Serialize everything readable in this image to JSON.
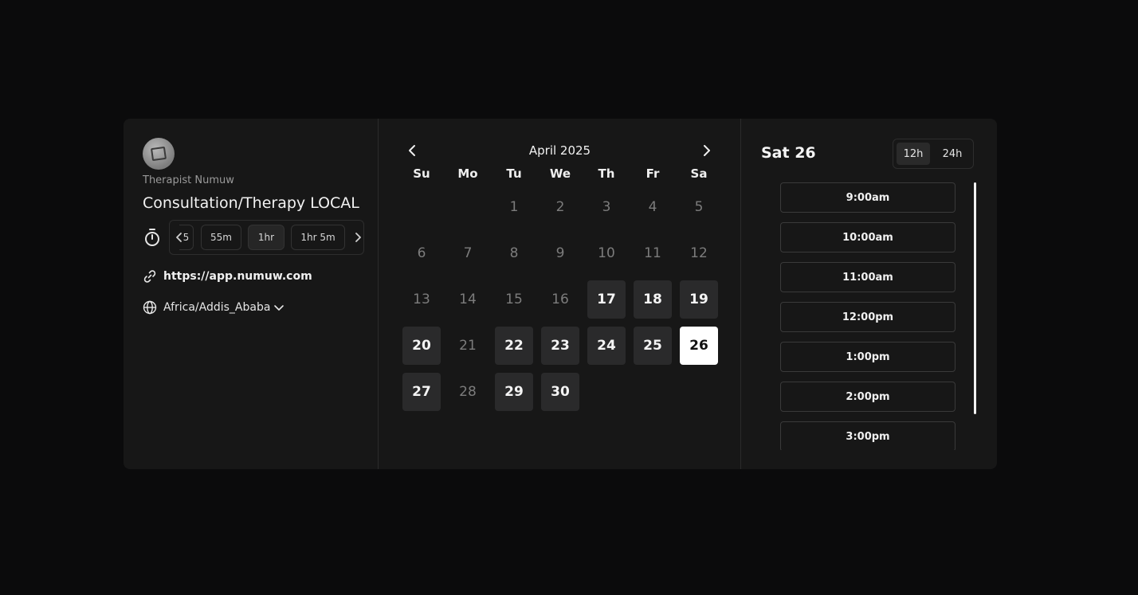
{
  "profile": {
    "host_name": "Therapist Numuw",
    "event_title": "Consultation/Therapy LOCAL",
    "link": "https://app.numuw.com",
    "timezone": "Africa/Addis_Ababa"
  },
  "durations": {
    "partial_label": "5",
    "options": [
      "55m",
      "1hr",
      "1hr 5m"
    ],
    "selected": "1hr"
  },
  "calendar": {
    "month_label": "April 2025",
    "weekdays": [
      "Su",
      "Mo",
      "Tu",
      "We",
      "Th",
      "Fr",
      "Sa"
    ],
    "leading_blanks": 2,
    "days": [
      {
        "n": "1",
        "state": "disabled"
      },
      {
        "n": "2",
        "state": "disabled"
      },
      {
        "n": "3",
        "state": "disabled"
      },
      {
        "n": "4",
        "state": "disabled"
      },
      {
        "n": "5",
        "state": "disabled"
      },
      {
        "n": "6",
        "state": "disabled"
      },
      {
        "n": "7",
        "state": "disabled"
      },
      {
        "n": "8",
        "state": "disabled"
      },
      {
        "n": "9",
        "state": "disabled"
      },
      {
        "n": "10",
        "state": "disabled"
      },
      {
        "n": "11",
        "state": "disabled"
      },
      {
        "n": "12",
        "state": "disabled"
      },
      {
        "n": "13",
        "state": "disabled"
      },
      {
        "n": "14",
        "state": "disabled"
      },
      {
        "n": "15",
        "state": "disabled"
      },
      {
        "n": "16",
        "state": "disabled"
      },
      {
        "n": "17",
        "state": "available"
      },
      {
        "n": "18",
        "state": "available"
      },
      {
        "n": "19",
        "state": "available"
      },
      {
        "n": "20",
        "state": "available"
      },
      {
        "n": "21",
        "state": "disabled"
      },
      {
        "n": "22",
        "state": "available"
      },
      {
        "n": "23",
        "state": "available"
      },
      {
        "n": "24",
        "state": "available"
      },
      {
        "n": "25",
        "state": "available"
      },
      {
        "n": "26",
        "state": "selected"
      },
      {
        "n": "27",
        "state": "available"
      },
      {
        "n": "28",
        "state": "disabled"
      },
      {
        "n": "29",
        "state": "available"
      },
      {
        "n": "30",
        "state": "available"
      }
    ]
  },
  "schedule": {
    "selected_date": "Sat 26",
    "format_options": [
      "12h",
      "24h"
    ],
    "selected_format": "12h",
    "slots": [
      "9:00am",
      "10:00am",
      "11:00am",
      "12:00pm",
      "1:00pm",
      "2:00pm",
      "3:00pm"
    ]
  },
  "colors": {
    "background": "#0b0b0c",
    "card": "#171717",
    "available_day": "#2a2a2b",
    "selected_day": "#ffffff"
  }
}
